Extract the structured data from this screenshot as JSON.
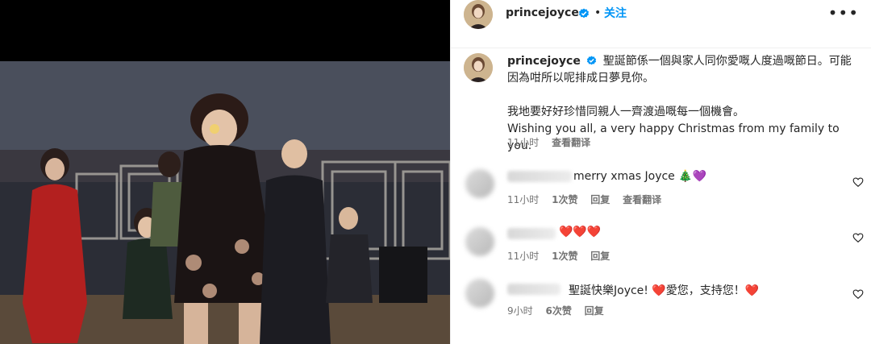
{
  "post": {
    "username": "princejoyce",
    "follow_label": "关注",
    "dot": "•",
    "more_icon": "more-horizontal-icon",
    "caption_lines": [
      "聖誕節係一個與家人同你愛嘅人度過嘅節日。可能",
      "因為咁所以呢排成日夢見你。",
      "",
      "我地要好好珍惜同親人一齊渡過嘅每一個機會。",
      "Wishing you all, a very happy Christmas from my family to you."
    ],
    "time": "11小时",
    "translate": "查看翻译"
  },
  "comments": [
    {
      "text": "merry xmas Joyce 🎄💜",
      "time": "11小时",
      "likes": "1次赞",
      "reply": "回复",
      "translate": "查看翻译"
    },
    {
      "text": "❤️❤️❤️",
      "time": "11小时",
      "likes": "1次赞",
      "reply": "回复"
    },
    {
      "text": "聖誕快樂Joyce! ❤️愛您，支持您！❤️",
      "time": "9小时",
      "likes": "6次赞",
      "reply": "回复"
    }
  ],
  "colors": {
    "follow": "#0095f6",
    "verified": "#0095f6",
    "meta": "#737373"
  }
}
